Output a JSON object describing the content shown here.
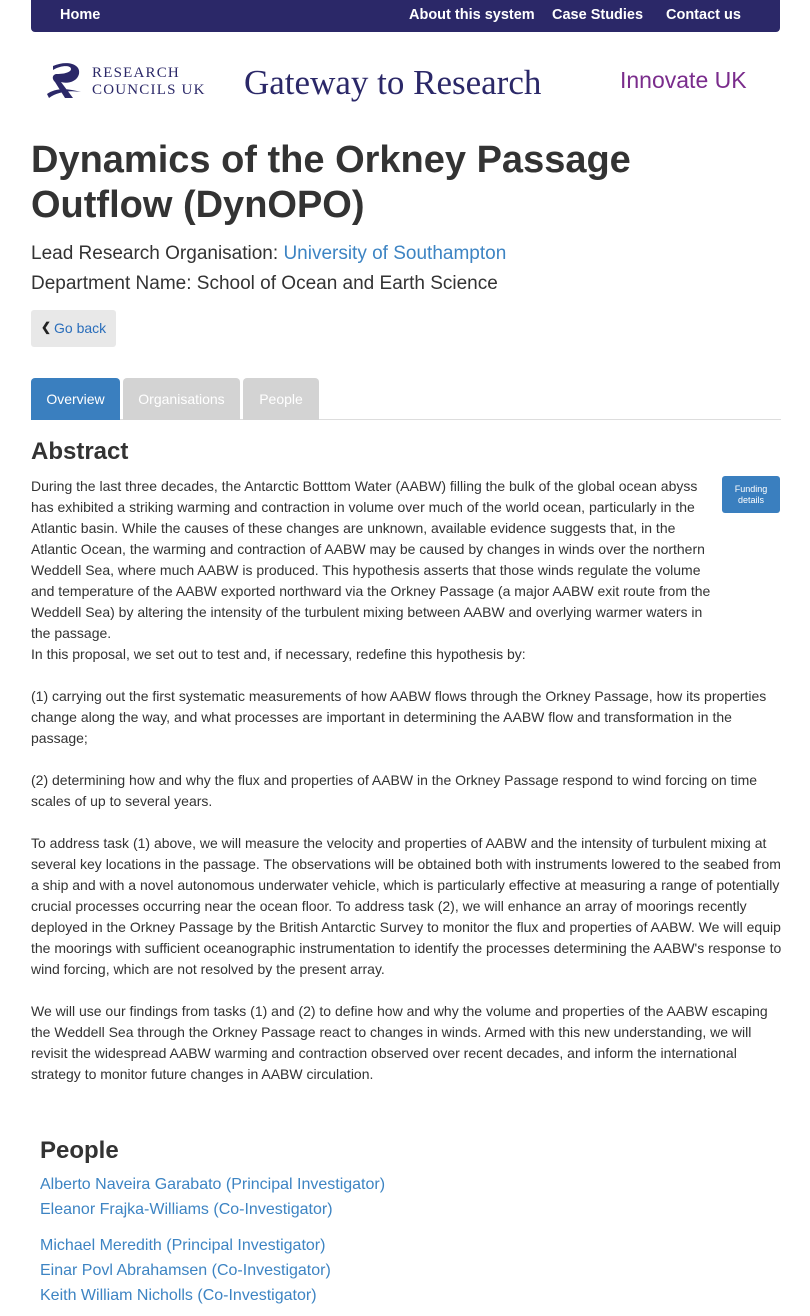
{
  "nav": {
    "home": "Home",
    "about": "About this system",
    "case_studies": "Case Studies",
    "contact": "Contact us"
  },
  "header": {
    "rcuk_line1": "RESEARCH",
    "rcuk_line2": "COUNCILS UK",
    "gateway": "Gateway to Research",
    "innovate": "Innovate UK"
  },
  "project": {
    "title": "Dynamics of the Orkney Passage Outflow (DynOPO)",
    "lead_org_label": "Lead Research Organisation:",
    "lead_org": "University of Southampton",
    "department_label": "Department Name:",
    "department": "School of Ocean and Earth Science"
  },
  "go_back": "Go back",
  "tabs": [
    {
      "label": "Overview",
      "active": true
    },
    {
      "label": "Organisations",
      "active": false
    },
    {
      "label": "People",
      "active": false
    }
  ],
  "abstract": {
    "heading": "Abstract",
    "funding_button_line1": "Funding",
    "funding_button_line2": "details",
    "paragraphs": [
      "During the last three decades, the Antarctic Botttom Water (AABW) filling the bulk of the global ocean abyss has exhibited a striking warming and contraction in volume over much of the world ocean, particularly in the Atlantic basin. While the causes of these changes are unknown, available evidence suggests that, in the Atlantic Ocean, the warming and contraction of AABW may be caused by changes in winds over the northern Weddell Sea, where much AABW is produced. This hypothesis asserts that those winds regulate the volume and temperature of the AABW exported northward via the Orkney Passage (a major AABW exit route from the Weddell Sea) by altering the intensity of the turbulent mixing between AABW and overlying warmer waters in the passage.",
      "In this proposal, we set out to test and, if necessary, redefine this hypothesis by:",
      "(1) carrying out the first systematic measurements of how AABW flows through the Orkney Passage, how its properties change along the way, and what processes are important in determining the AABW flow and transformation in the passage;",
      "(2) determining how and why the flux and properties of AABW in the Orkney Passage respond to wind forcing on time scales of up to several years.",
      "To address task (1) above, we will measure the velocity and properties of AABW and the intensity of turbulent mixing at several key locations in the passage. The observations will be obtained both with instruments lowered to the seabed from a ship and with a novel autonomous underwater vehicle, which is particularly effective at measuring a range of potentially crucial processes occurring near the ocean floor. To address task (2), we will enhance an array of moorings recently deployed in the Orkney Passage by the British Antarctic Survey to monitor the flux and properties of AABW. We will equip the moorings with sufficient oceanographic instrumentation to identify the processes determining the AABW's response to wind forcing, which are not resolved by the present array.",
      "We will use our findings from tasks (1) and (2) to define how and why the volume and properties of the AABW escaping the Weddell Sea through the Orkney Passage react to changes in winds. Armed with this new understanding, we will revisit the widespread AABW warming and contraction observed over recent decades, and inform the international strategy to monitor future changes in AABW circulation."
    ]
  },
  "people": {
    "heading": "People",
    "list": [
      "Alberto Naveira Garabato (Principal Investigator)",
      "Eleanor Frajka-Williams (Co-Investigator)",
      "Michael Meredith (Principal Investigator)",
      "Einar Povl Abrahamsen (Co-Investigator)",
      "Keith William Nicholls (Co-Investigator)"
    ]
  },
  "colors": {
    "navbar": "#2b2868",
    "link": "#3d84c3",
    "tab_active": "#3a7fbf",
    "tab_inactive": "#d3d3d3",
    "innovate": "#7a2c8c"
  }
}
